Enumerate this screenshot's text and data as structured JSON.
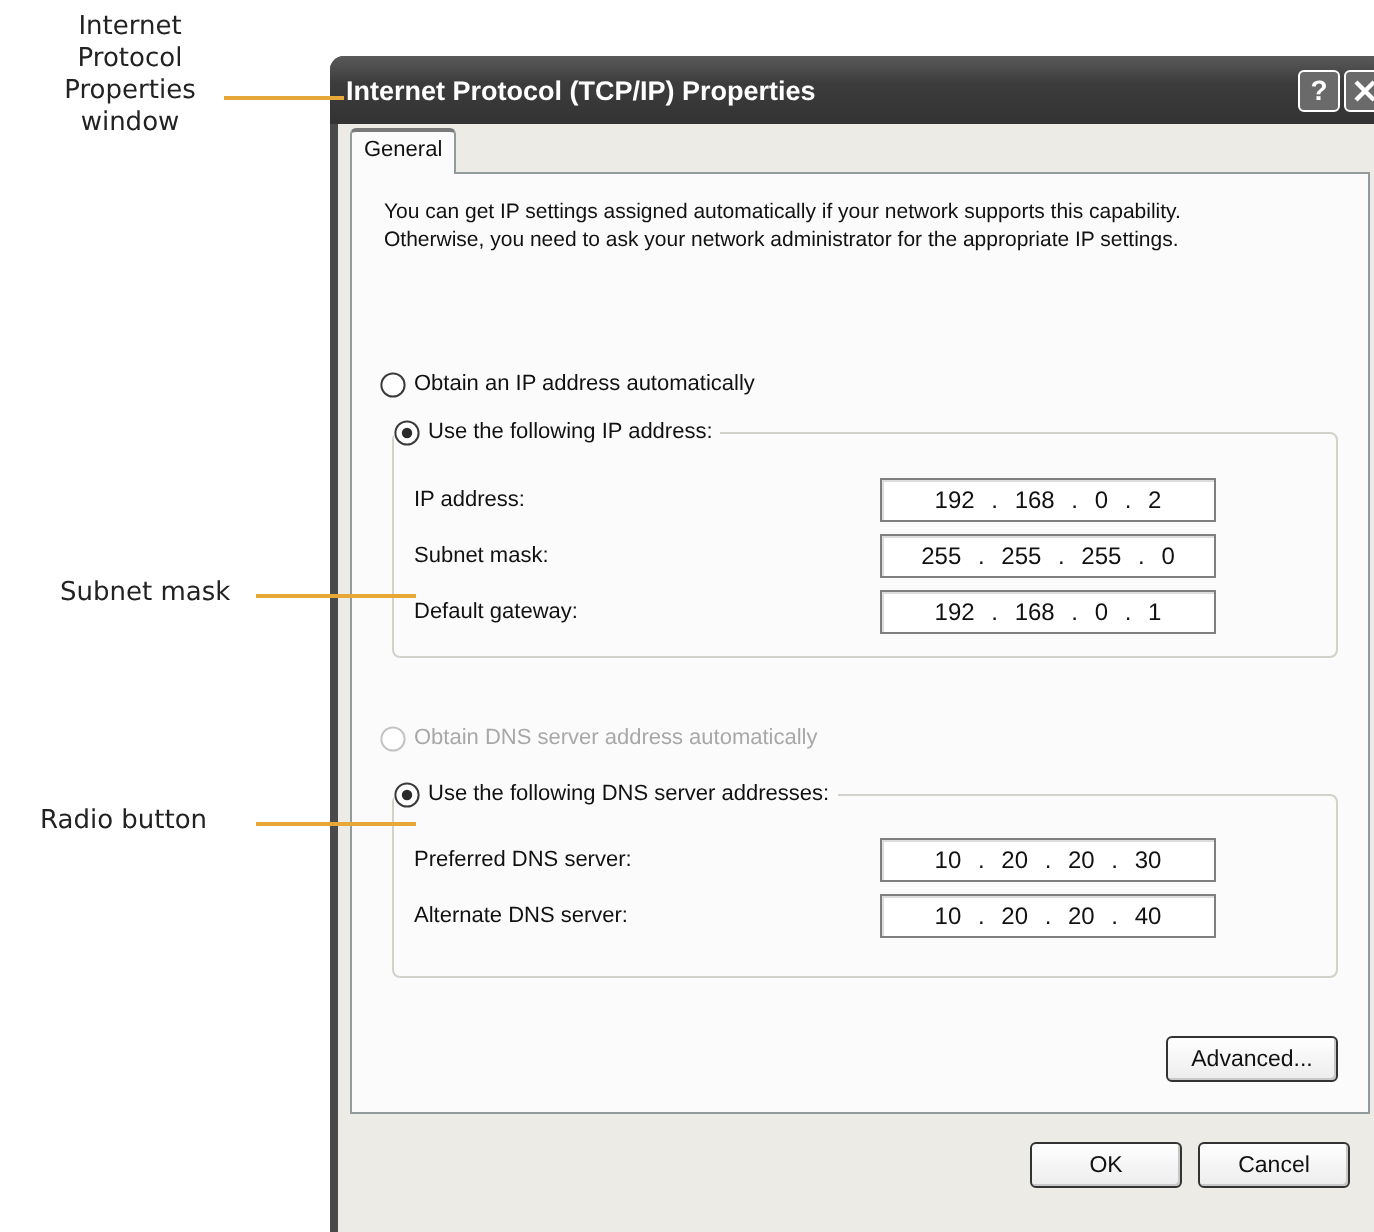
{
  "callouts": [
    {
      "text": "Internet Protocol Properties window"
    },
    {
      "text": "Subnet mask"
    },
    {
      "text": "Radio button"
    }
  ],
  "window": {
    "title": "Internet Protocol (TCP/IP) Properties",
    "help_button": "?"
  },
  "tabs": [
    {
      "label": "General",
      "selected": true
    }
  ],
  "description": "You can get IP settings assigned automatically if your network supports this capability. Otherwise, you need to ask your network administrator for the appropriate IP settings.",
  "ip_section": {
    "radios": [
      {
        "label": "Obtain an IP address automatically",
        "selected": false,
        "disabled": false
      },
      {
        "label": "Use the following IP address:",
        "selected": true,
        "disabled": false
      }
    ],
    "fields": [
      {
        "label": "IP address:",
        "value": "192 . 168 . 0 . 2"
      },
      {
        "label": "Subnet mask:",
        "value": "255 . 255 . 255 . 0"
      },
      {
        "label": "Default gateway:",
        "value": "192 . 168 . 0 . 1"
      }
    ]
  },
  "dns_section": {
    "radios": [
      {
        "label": "Obtain DNS server address automatically",
        "selected": false,
        "disabled": true
      },
      {
        "label": "Use the following DNS server addresses:",
        "selected": true,
        "disabled": false
      }
    ],
    "fields": [
      {
        "label": "Preferred DNS server:",
        "value": "10 . 20 . 20 . 30"
      },
      {
        "label": "Alternate DNS server:",
        "value": "10 . 20 . 20 . 40"
      }
    ]
  },
  "advanced_button": "Advanced...",
  "buttons": [
    "OK",
    "Cancel"
  ]
}
